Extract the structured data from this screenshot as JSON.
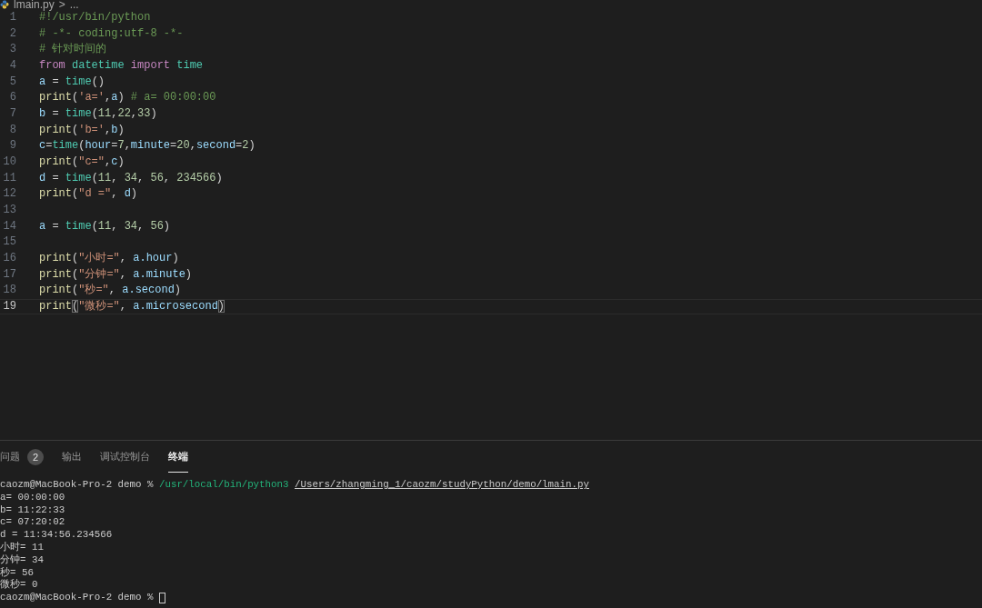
{
  "breadcrumb": {
    "file": "lmain.py",
    "separator": ">",
    "more": "..."
  },
  "editor": {
    "lines": [
      {
        "number": "1",
        "current": false,
        "tokens": [
          {
            "text": "#!/usr/bin/python",
            "kind": "comment"
          }
        ]
      },
      {
        "number": "2",
        "current": false,
        "tokens": [
          {
            "text": "# -*- coding:utf-8 -*-",
            "kind": "comment"
          }
        ]
      },
      {
        "number": "3",
        "current": false,
        "tokens": [
          {
            "text": "# 针对时间的",
            "kind": "comment"
          }
        ]
      },
      {
        "number": "4",
        "current": false,
        "tokens": [
          {
            "text": "from",
            "kind": "keyword"
          },
          {
            "text": " datetime",
            "kind": "class"
          },
          {
            "text": " import",
            "kind": "keyword"
          },
          {
            "text": " time",
            "kind": "class"
          }
        ]
      },
      {
        "number": "5",
        "current": false,
        "tokens": [
          {
            "text": "a",
            "kind": "variable"
          },
          {
            "text": " = ",
            "kind": "plain"
          },
          {
            "text": "time",
            "kind": "class"
          },
          {
            "text": "()",
            "kind": "plain"
          }
        ]
      },
      {
        "number": "6",
        "current": false,
        "tokens": [
          {
            "text": "print",
            "kind": "function"
          },
          {
            "text": "(",
            "kind": "plain"
          },
          {
            "text": "'a='",
            "kind": "string"
          },
          {
            "text": ",",
            "kind": "plain"
          },
          {
            "text": "a",
            "kind": "variable"
          },
          {
            "text": ") ",
            "kind": "plain"
          },
          {
            "text": "# a= 00:00:00",
            "kind": "comment"
          }
        ]
      },
      {
        "number": "7",
        "current": false,
        "tokens": [
          {
            "text": "b",
            "kind": "variable"
          },
          {
            "text": " = ",
            "kind": "plain"
          },
          {
            "text": "time",
            "kind": "class"
          },
          {
            "text": "(",
            "kind": "plain"
          },
          {
            "text": "11",
            "kind": "number"
          },
          {
            "text": ",",
            "kind": "plain"
          },
          {
            "text": "22",
            "kind": "number"
          },
          {
            "text": ",",
            "kind": "plain"
          },
          {
            "text": "33",
            "kind": "number"
          },
          {
            "text": ")",
            "kind": "plain"
          }
        ]
      },
      {
        "number": "8",
        "current": false,
        "tokens": [
          {
            "text": "print",
            "kind": "function"
          },
          {
            "text": "(",
            "kind": "plain"
          },
          {
            "text": "'b='",
            "kind": "string"
          },
          {
            "text": ",",
            "kind": "plain"
          },
          {
            "text": "b",
            "kind": "variable"
          },
          {
            "text": ")",
            "kind": "plain"
          }
        ]
      },
      {
        "number": "9",
        "current": false,
        "tokens": [
          {
            "text": "c",
            "kind": "variable"
          },
          {
            "text": "=",
            "kind": "plain"
          },
          {
            "text": "time",
            "kind": "class"
          },
          {
            "text": "(",
            "kind": "plain"
          },
          {
            "text": "hour",
            "kind": "variable"
          },
          {
            "text": "=",
            "kind": "plain"
          },
          {
            "text": "7",
            "kind": "number"
          },
          {
            "text": ",",
            "kind": "plain"
          },
          {
            "text": "minute",
            "kind": "variable"
          },
          {
            "text": "=",
            "kind": "plain"
          },
          {
            "text": "20",
            "kind": "number"
          },
          {
            "text": ",",
            "kind": "plain"
          },
          {
            "text": "second",
            "kind": "variable"
          },
          {
            "text": "=",
            "kind": "plain"
          },
          {
            "text": "2",
            "kind": "number"
          },
          {
            "text": ")",
            "kind": "plain"
          }
        ]
      },
      {
        "number": "10",
        "current": false,
        "tokens": [
          {
            "text": "print",
            "kind": "function"
          },
          {
            "text": "(",
            "kind": "plain"
          },
          {
            "text": "\"c=\"",
            "kind": "string"
          },
          {
            "text": ",",
            "kind": "plain"
          },
          {
            "text": "c",
            "kind": "variable"
          },
          {
            "text": ")",
            "kind": "plain"
          }
        ]
      },
      {
        "number": "11",
        "current": false,
        "tokens": [
          {
            "text": "d",
            "kind": "variable"
          },
          {
            "text": " = ",
            "kind": "plain"
          },
          {
            "text": "time",
            "kind": "class"
          },
          {
            "text": "(",
            "kind": "plain"
          },
          {
            "text": "11",
            "kind": "number"
          },
          {
            "text": ", ",
            "kind": "plain"
          },
          {
            "text": "34",
            "kind": "number"
          },
          {
            "text": ", ",
            "kind": "plain"
          },
          {
            "text": "56",
            "kind": "number"
          },
          {
            "text": ", ",
            "kind": "plain"
          },
          {
            "text": "234566",
            "kind": "number"
          },
          {
            "text": ")",
            "kind": "plain"
          }
        ]
      },
      {
        "number": "12",
        "current": false,
        "tokens": [
          {
            "text": "print",
            "kind": "function"
          },
          {
            "text": "(",
            "kind": "plain"
          },
          {
            "text": "\"d =\"",
            "kind": "string"
          },
          {
            "text": ", ",
            "kind": "plain"
          },
          {
            "text": "d",
            "kind": "variable"
          },
          {
            "text": ")",
            "kind": "plain"
          }
        ]
      },
      {
        "number": "13",
        "current": false
      },
      {
        "number": "14",
        "current": false,
        "tokens": [
          {
            "text": "a",
            "kind": "variable"
          },
          {
            "text": " = ",
            "kind": "plain"
          },
          {
            "text": "time",
            "kind": "class"
          },
          {
            "text": "(",
            "kind": "plain"
          },
          {
            "text": "11",
            "kind": "number"
          },
          {
            "text": ", ",
            "kind": "plain"
          },
          {
            "text": "34",
            "kind": "number"
          },
          {
            "text": ", ",
            "kind": "plain"
          },
          {
            "text": "56",
            "kind": "number"
          },
          {
            "text": ")",
            "kind": "plain"
          }
        ]
      },
      {
        "number": "15",
        "current": false
      },
      {
        "number": "16",
        "current": false,
        "tokens": [
          {
            "text": "print",
            "kind": "function"
          },
          {
            "text": "(",
            "kind": "plain"
          },
          {
            "text": "\"小时=\"",
            "kind": "string"
          },
          {
            "text": ", ",
            "kind": "plain"
          },
          {
            "text": "a.hour",
            "kind": "variable"
          },
          {
            "text": ")",
            "kind": "plain"
          }
        ]
      },
      {
        "number": "17",
        "current": false,
        "tokens": [
          {
            "text": "print",
            "kind": "function"
          },
          {
            "text": "(",
            "kind": "plain"
          },
          {
            "text": "\"分钟=\"",
            "kind": "string"
          },
          {
            "text": ", ",
            "kind": "plain"
          },
          {
            "text": "a.minute",
            "kind": "variable"
          },
          {
            "text": ")",
            "kind": "plain"
          }
        ]
      },
      {
        "number": "18",
        "current": false,
        "tokens": [
          {
            "text": "print",
            "kind": "function"
          },
          {
            "text": "(",
            "kind": "plain"
          },
          {
            "text": "\"秒=\"",
            "kind": "string"
          },
          {
            "text": ", ",
            "kind": "plain"
          },
          {
            "text": "a.second",
            "kind": "variable"
          },
          {
            "text": ")",
            "kind": "plain"
          }
        ]
      },
      {
        "number": "19",
        "current": true,
        "tokens": [
          {
            "text": "print",
            "kind": "function"
          },
          {
            "text": "(",
            "kind": "bracket"
          },
          {
            "text": "\"微秒=\"",
            "kind": "string"
          },
          {
            "text": ", ",
            "kind": "plain"
          },
          {
            "text": "a.microsecond",
            "kind": "variable"
          },
          {
            "text": ")",
            "kind": "bracket"
          }
        ]
      }
    ]
  },
  "panel": {
    "tabs": [
      {
        "label": "问题",
        "badge": "2",
        "selected": false
      },
      {
        "label": "输出",
        "selected": false
      },
      {
        "label": "调试控制台",
        "selected": false
      },
      {
        "label": "终端",
        "selected": true
      }
    ],
    "terminal": {
      "lines": [
        {
          "segments": [
            {
              "text": "caozm@MacBook-Pro-2 demo % ",
              "kind": "plain"
            },
            {
              "text": "/usr/local/bin/python3 ",
              "kind": "command"
            },
            {
              "text": "/Users/zhangming_1/caozm/studyPython/demo/lmain.py",
              "kind": "link"
            }
          ]
        },
        {
          "segments": [
            {
              "text": "a= 00:00:00",
              "kind": "plain"
            }
          ]
        },
        {
          "segments": [
            {
              "text": "b= 11:22:33",
              "kind": "plain"
            }
          ]
        },
        {
          "segments": [
            {
              "text": "c= 07:20:02",
              "kind": "plain"
            }
          ]
        },
        {
          "segments": [
            {
              "text": "d = 11:34:56.234566",
              "kind": "plain"
            }
          ]
        },
        {
          "segments": [
            {
              "text": "小时= 11",
              "kind": "plain"
            }
          ]
        },
        {
          "segments": [
            {
              "text": "分钟= 34",
              "kind": "plain"
            }
          ]
        },
        {
          "segments": [
            {
              "text": "秒= 56",
              "kind": "plain"
            }
          ]
        },
        {
          "segments": [
            {
              "text": "微秒= 0",
              "kind": "plain"
            }
          ]
        },
        {
          "segments": [
            {
              "text": "caozm@MacBook-Pro-2 demo % ",
              "kind": "plain"
            },
            {
              "kind": "cursor"
            }
          ]
        }
      ]
    }
  }
}
